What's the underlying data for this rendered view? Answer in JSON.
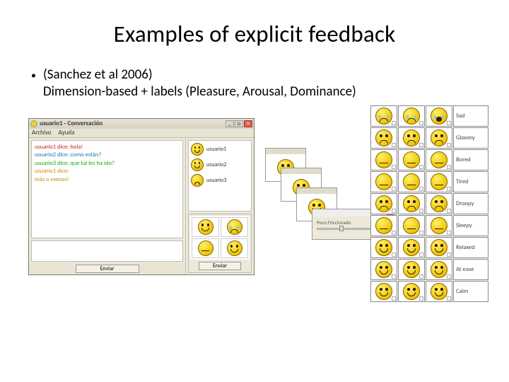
{
  "title": "Examples of explicit feedback",
  "bullet": {
    "citation": "(Sanchez et al 2006)",
    "desc": "Dimension-based + labels (Pleasure, Arousal, Dominance)"
  },
  "chat_window": {
    "title": "usuario1 - Conversación",
    "menu": [
      "Archivo",
      "Ayuda"
    ],
    "messages": [
      {
        "cls": "l1",
        "text": "usuario1 dice: hola!"
      },
      {
        "cls": "l2",
        "text": "usuario2 dice: como están?"
      },
      {
        "cls": "l3",
        "text": "usuario3 dice: que tal les ha ido?"
      },
      {
        "cls": "l4",
        "text": "usuario1 dice:"
      },
      {
        "cls": "l4",
        "text": "más o menos!"
      }
    ],
    "send_label": "Enviar",
    "users": [
      {
        "name": "usuario1",
        "face": "smile"
      },
      {
        "name": "usuario2",
        "face": "smile"
      },
      {
        "name": "usuario3",
        "face": "angry frown"
      }
    ],
    "selector_faces": [
      "smile",
      "cry frown",
      "sleepy flat",
      "smile"
    ]
  },
  "slider_popup": {
    "label": "Poco Friccionado"
  },
  "emoji_grid": {
    "rows": [
      {
        "faces": [
          "cry frown",
          "cry frown",
          "cry open"
        ],
        "label": "Sad"
      },
      {
        "faces": [
          "frown smile",
          "frown smile",
          "frown smile"
        ],
        "label": "Gloomy"
      },
      {
        "faces": [
          "sleepy flat",
          "sleepy flat",
          "sleepy flat"
        ],
        "label": "Bored"
      },
      {
        "faces": [
          "sleepy flat",
          "sleepy flat",
          "sleepy flat"
        ],
        "label": "Tired"
      },
      {
        "faces": [
          "frown smile",
          "frown smile",
          "frown smile"
        ],
        "label": "Droopy"
      },
      {
        "faces": [
          "sleepy flat",
          "sleepy flat",
          "sleepy flat"
        ],
        "label": "Sleepy"
      },
      {
        "faces": [
          "smile",
          "smile",
          "smile"
        ],
        "label": "Relaxed"
      },
      {
        "faces": [
          "smile",
          "smile",
          "smile"
        ],
        "label": "At ease"
      },
      {
        "faces": [
          "smile",
          "smile",
          "smile"
        ],
        "label": "Calm"
      }
    ]
  }
}
